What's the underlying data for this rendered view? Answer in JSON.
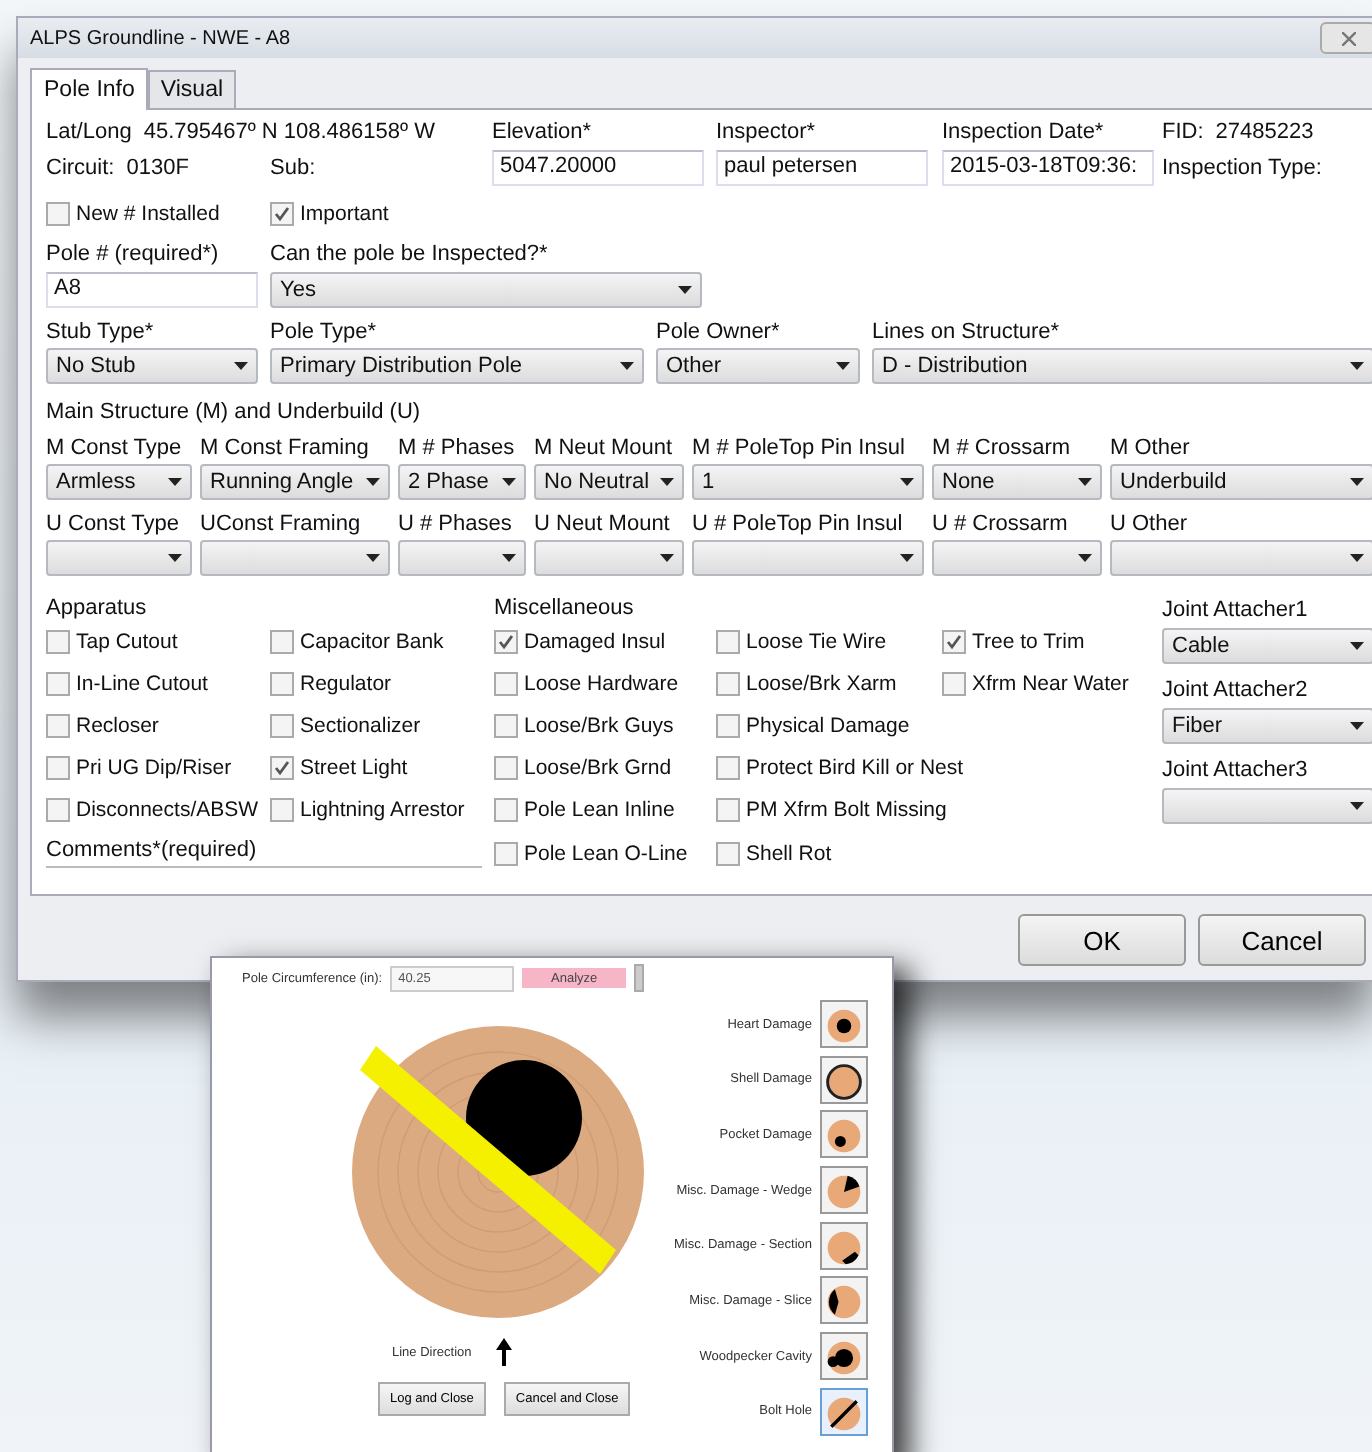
{
  "window": {
    "title": "ALPS Groundline - NWE - A8"
  },
  "tabs": [
    {
      "label": "Pole Info",
      "selected": true
    },
    {
      "label": "Visual",
      "selected": false
    }
  ],
  "header": {
    "lat_long": {
      "label": "Lat/Long",
      "value": "45.795467º N 108.486158º W"
    },
    "circuit": {
      "label": "Circuit:",
      "value": "0130F"
    },
    "sub": {
      "label": "Sub:"
    },
    "fields": [
      {
        "label": "Elevation*",
        "value": "5047.20000"
      },
      {
        "label": "Inspector*",
        "value": "paul petersen"
      },
      {
        "label": "Inspection Date*",
        "value": "2015-03-18T09:36:"
      }
    ],
    "fid": {
      "label": "FID:",
      "value": "27485223"
    },
    "inspection_type": {
      "label": "Inspection Type:"
    }
  },
  "flags": [
    {
      "label": "New # Installed",
      "checked": false
    },
    {
      "label": "Important",
      "checked": true
    }
  ],
  "pole_number": {
    "label": "Pole # (required*)",
    "value": "A8"
  },
  "inspectable": {
    "label": "Can the pole be Inspected?*",
    "value": "Yes"
  },
  "structure": [
    {
      "label": "Stub Type*",
      "value": "No Stub"
    },
    {
      "label": "Pole Type*",
      "value": "Primary Distribution Pole"
    },
    {
      "label": "Pole Owner*",
      "value": "Other"
    },
    {
      "label": "Lines on Structure*",
      "value": "D - Distribution"
    }
  ],
  "section_title": "Main Structure (M) and Underbuild (U)",
  "main_row": [
    {
      "label": "M Const Type",
      "value": "Armless"
    },
    {
      "label": "M Const Framing",
      "value": "Running Angle"
    },
    {
      "label": "M # Phases",
      "value": "2 Phase"
    },
    {
      "label": "M Neut Mount",
      "value": "No Neutral"
    },
    {
      "label": "M # PoleTop Pin Insul",
      "value": "1"
    },
    {
      "label": "M # Crossarm",
      "value": "None"
    },
    {
      "label": "M Other",
      "value": "Underbuild"
    }
  ],
  "under_row": [
    {
      "label": "U Const Type"
    },
    {
      "label": "UConst Framing"
    },
    {
      "label": "U # Phases"
    },
    {
      "label": "U Neut Mount"
    },
    {
      "label": "U # PoleTop Pin Insul"
    },
    {
      "label": "U # Crossarm"
    },
    {
      "label": "U Other"
    }
  ],
  "apparatus": {
    "title": "Apparatus",
    "columns": [
      [
        {
          "label": "Tap Cutout",
          "checked": false
        },
        {
          "label": "In-Line Cutout",
          "checked": false
        },
        {
          "label": "Recloser",
          "checked": false
        },
        {
          "label": "Pri UG Dip/Riser",
          "checked": false
        },
        {
          "label": "Disconnects/ABSW",
          "checked": false
        }
      ],
      [
        {
          "label": "Capacitor Bank",
          "checked": false
        },
        {
          "label": "Regulator",
          "checked": false
        },
        {
          "label": "Sectionalizer",
          "checked": false
        },
        {
          "label": "Street Light",
          "checked": true
        },
        {
          "label": "Lightning Arrestor",
          "checked": false
        }
      ]
    ]
  },
  "miscellaneous": {
    "title": "Miscellaneous",
    "columns": [
      [
        {
          "label": "Damaged Insul",
          "checked": true
        },
        {
          "label": "Loose Hardware",
          "checked": false
        },
        {
          "label": "Loose/Brk Guys",
          "checked": false
        },
        {
          "label": "Loose/Brk Grnd",
          "checked": false
        },
        {
          "label": "Pole Lean Inline",
          "checked": false
        },
        {
          "label": "Pole Lean O-Line",
          "checked": false
        }
      ],
      [
        {
          "label": "Loose Tie Wire",
          "checked": false
        },
        {
          "label": "Loose/Brk Xarm",
          "checked": false
        },
        {
          "label": "Physical Damage",
          "checked": false
        },
        {
          "label": "Protect Bird Kill or Nest",
          "checked": false
        },
        {
          "label": "PM Xfrm Bolt Missing",
          "checked": false
        },
        {
          "label": "Shell Rot",
          "checked": false
        }
      ],
      [
        {
          "label": "Tree to Trim",
          "checked": true
        },
        {
          "label": "Xfrm Near Water",
          "checked": false
        }
      ]
    ]
  },
  "joint_attachers": [
    {
      "label": "Joint Attacher1",
      "value": "Cable"
    },
    {
      "label": "Joint Attacher2",
      "value": "Fiber"
    },
    {
      "label": "Joint Attacher3"
    }
  ],
  "comments": {
    "label": "Comments*(required)"
  },
  "buttons": [
    "OK",
    "Cancel"
  ],
  "visual_window": {
    "circumference": {
      "label": "Pole Circumference (in):",
      "value": "40.25"
    },
    "analyze_button": "Analyze",
    "line_direction": "Line Direction",
    "damage_types": [
      {
        "label": "Heart Damage",
        "kind": "heart",
        "selected": false
      },
      {
        "label": "Shell Damage",
        "kind": "shell",
        "selected": false
      },
      {
        "label": "Pocket Damage",
        "kind": "pocket",
        "selected": false
      },
      {
        "label": "Misc. Damage - Wedge",
        "kind": "wedge",
        "selected": false
      },
      {
        "label": "Misc. Damage - Section",
        "kind": "section",
        "selected": false
      },
      {
        "label": "Misc. Damage - Slice",
        "kind": "slice",
        "selected": false
      },
      {
        "label": "Woodpecker Cavity",
        "kind": "woodpecker",
        "selected": false
      },
      {
        "label": "Bolt Hole",
        "kind": "bolt",
        "selected": true
      }
    ],
    "buttons": [
      "Log and Close",
      "Cancel and Close"
    ]
  }
}
